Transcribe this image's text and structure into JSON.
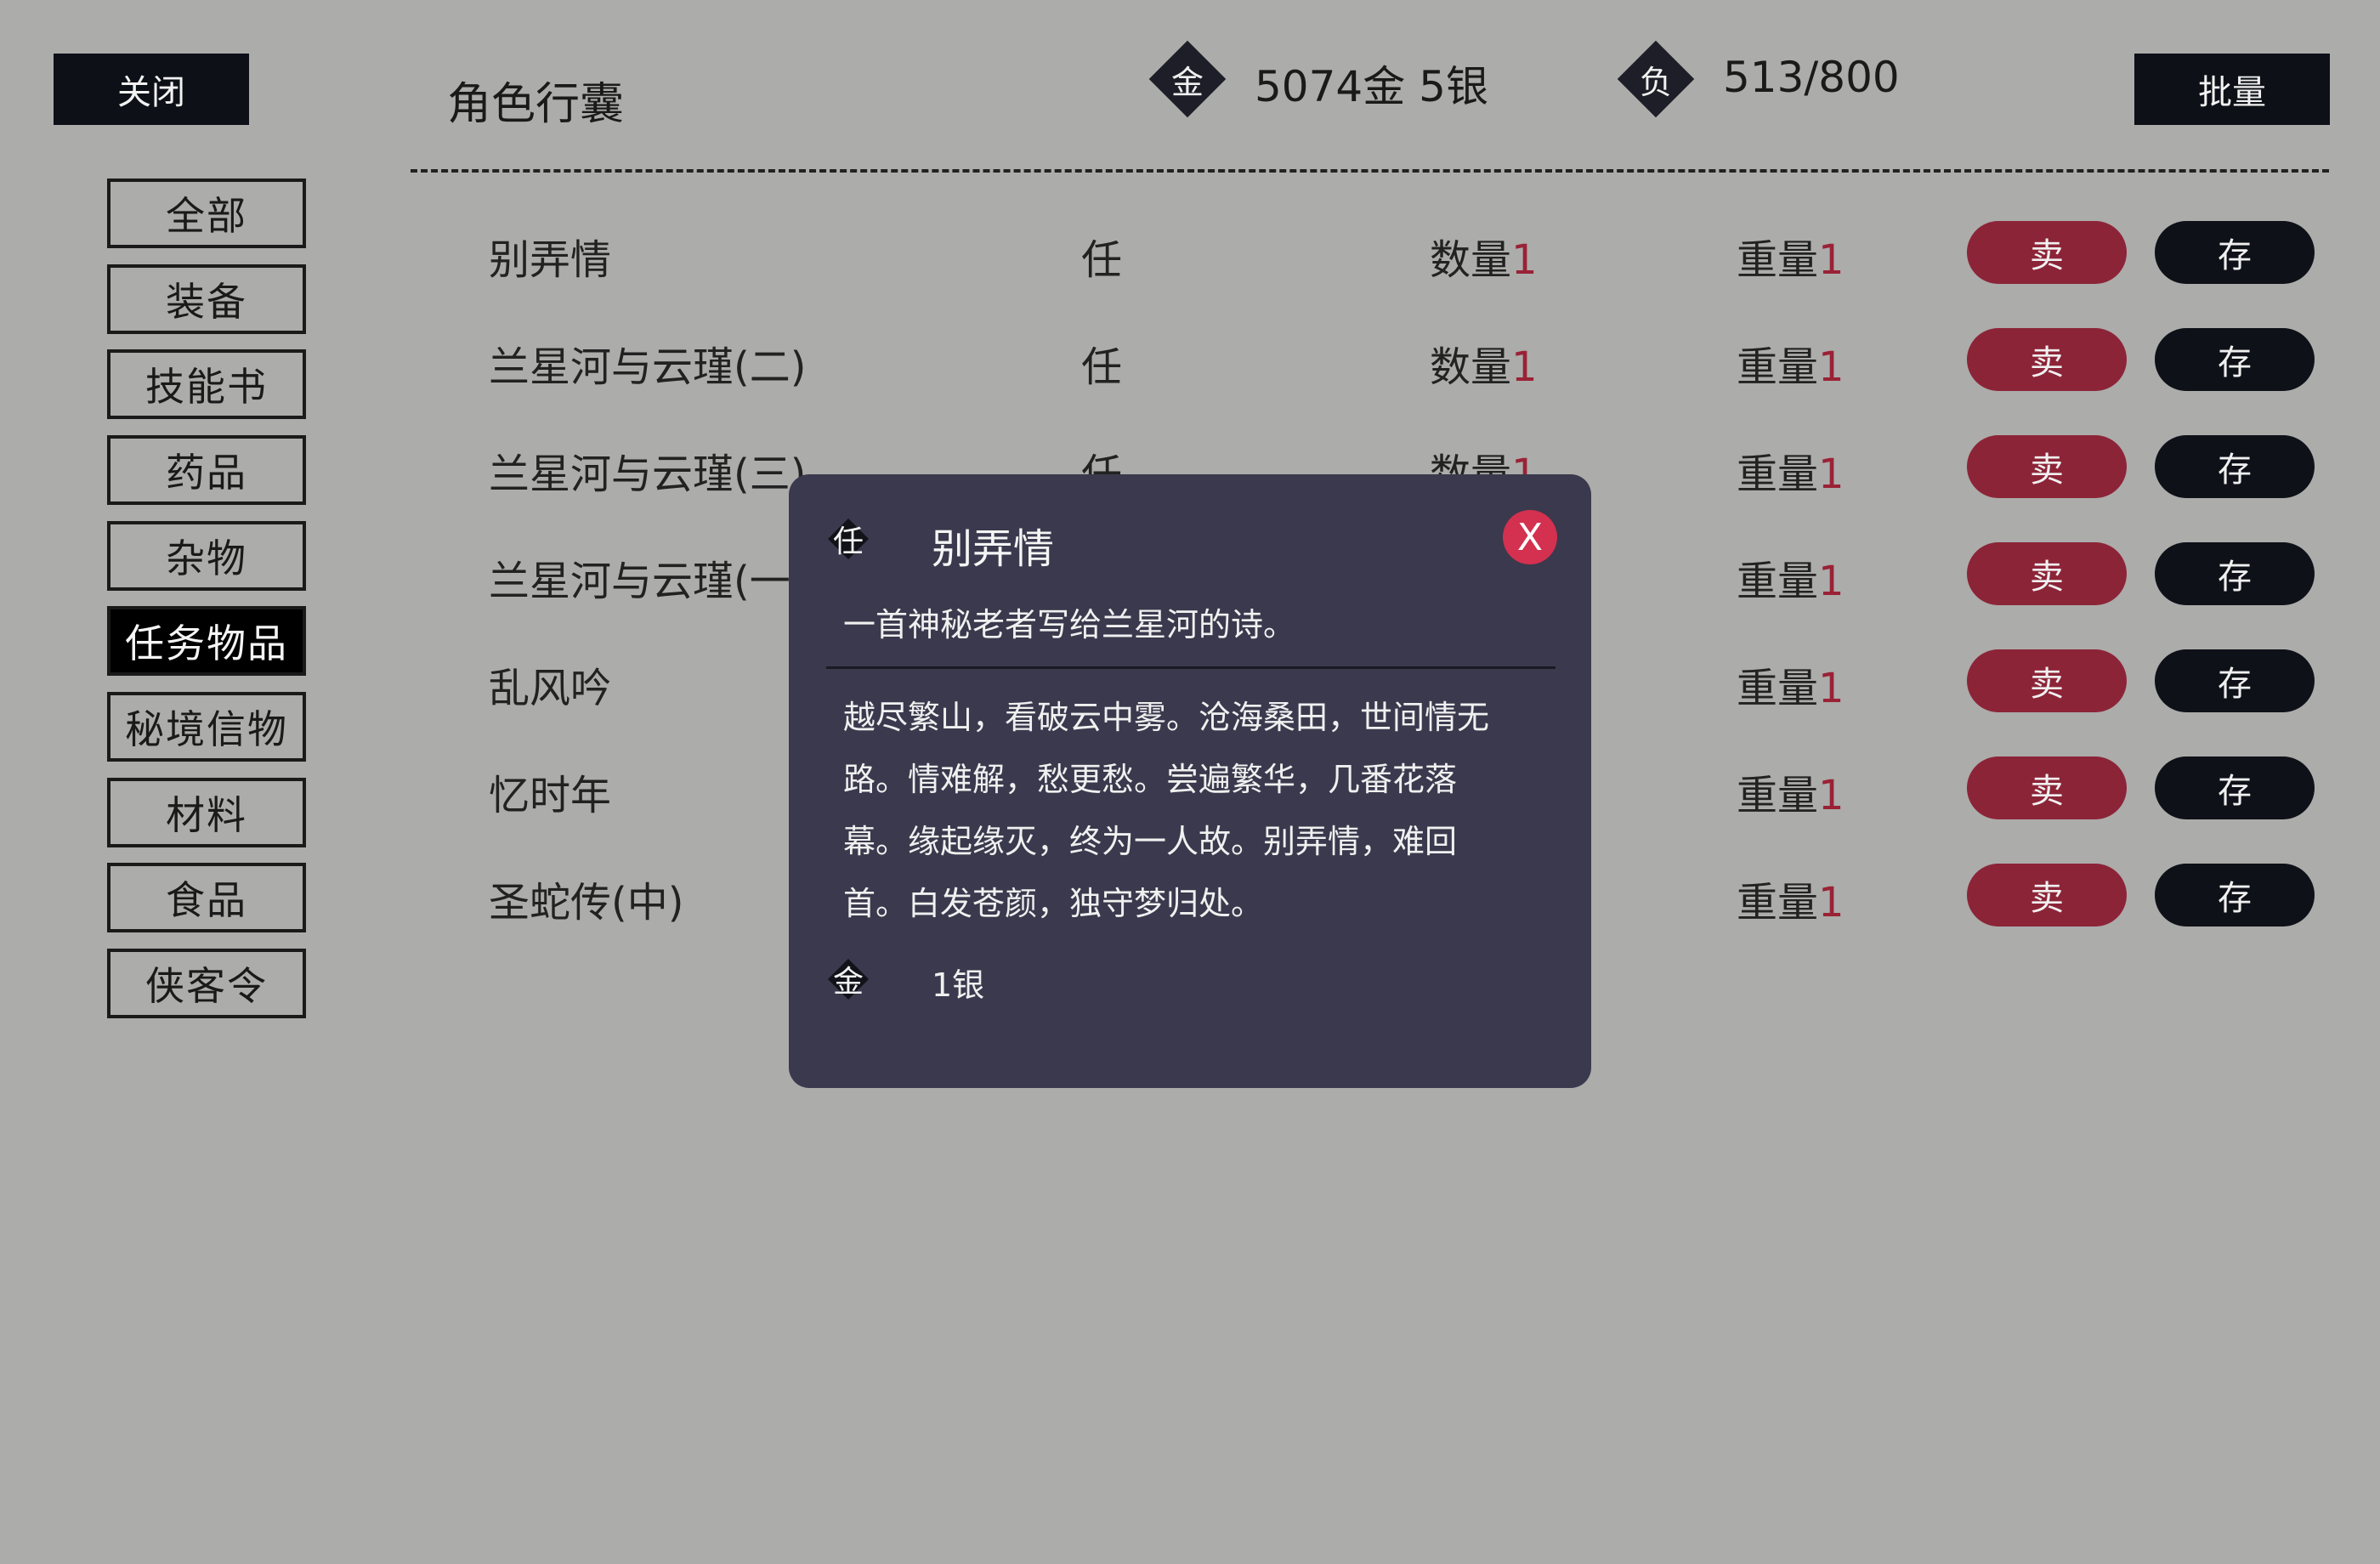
{
  "header": {
    "close_label": "关闭",
    "title": "角色行囊",
    "gold_icon": "金",
    "gold_value": "5074金 5银",
    "load_icon": "负",
    "load_value": "513/800",
    "batch_label": "批量"
  },
  "sidebar": {
    "items": [
      {
        "label": "全部",
        "active": false
      },
      {
        "label": "装备",
        "active": false
      },
      {
        "label": "技能书",
        "active": false
      },
      {
        "label": "药品",
        "active": false
      },
      {
        "label": "杂物",
        "active": false
      },
      {
        "label": "任务物品",
        "active": true
      },
      {
        "label": "秘境信物",
        "active": false
      },
      {
        "label": "材料",
        "active": false
      },
      {
        "label": "食品",
        "active": false
      },
      {
        "label": "侠客令",
        "active": false
      }
    ]
  },
  "labels": {
    "qty": "数量",
    "weight": "重量",
    "sell": "卖",
    "store": "存"
  },
  "items": [
    {
      "name": "别弄情",
      "type": "任",
      "qty": "1",
      "weight": "1"
    },
    {
      "name": "兰星河与云瑾(二)",
      "type": "任",
      "qty": "1",
      "weight": "1"
    },
    {
      "name": "兰星河与云瑾(三)",
      "type": "任",
      "qty": "1",
      "weight": "1"
    },
    {
      "name": "兰星河与云瑾(一",
      "type": "",
      "qty": "",
      "weight": "1"
    },
    {
      "name": "乱风吟",
      "type": "",
      "qty": "",
      "weight": "1"
    },
    {
      "name": "忆时年",
      "type": "",
      "qty": "",
      "weight": "1"
    },
    {
      "name": "圣蛇传(中)",
      "type": "",
      "qty": "",
      "weight": "1"
    }
  ],
  "popup": {
    "type_icon": "任",
    "title": "别弄情",
    "close_label": "X",
    "description": "一首神秘老者写给兰星河的诗。",
    "poem": [
      "越尽繁山，看破云中雾。沧海桑田，世间情无",
      "路。情难解，愁更愁。尝遍繁华，几番花落",
      "幕。缘起缘灭，终为一人故。别弄情，难回",
      "首。白发苍颜，独守梦归处。"
    ],
    "price_icon": "金",
    "price": "1银"
  },
  "colors": {
    "background": "#acacaa",
    "dark_button": "#0d1017",
    "sell_button": "#8c2438",
    "popup_bg": "#3b394d",
    "close_red": "#d4304f",
    "number_red": "#9a2236"
  }
}
